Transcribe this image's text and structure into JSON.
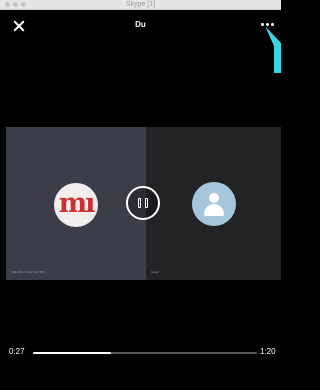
{
  "window": {
    "title": "Skype [1]"
  },
  "header": {
    "contact_name": "Du"
  },
  "participants": [
    {
      "label": "MIGUEL JOSÉ MARTIN",
      "avatar": "mi"
    },
    {
      "label": "Guest",
      "avatar": "default-person"
    }
  ],
  "playback": {
    "current_time": "0:27",
    "total_time": "1:20",
    "progress": 0.35
  },
  "icons": [
    "close-icon",
    "more-options-icon",
    "pause-icon",
    "person-icon",
    "cursor-arrow-icon"
  ],
  "colors": {
    "accent_cursor": "#3ad6e0",
    "panel_left": "#3b3d49",
    "panel_right": "#222325",
    "avatar_ring": "#a6c6dc",
    "mi_red": "#cc2f2f"
  }
}
